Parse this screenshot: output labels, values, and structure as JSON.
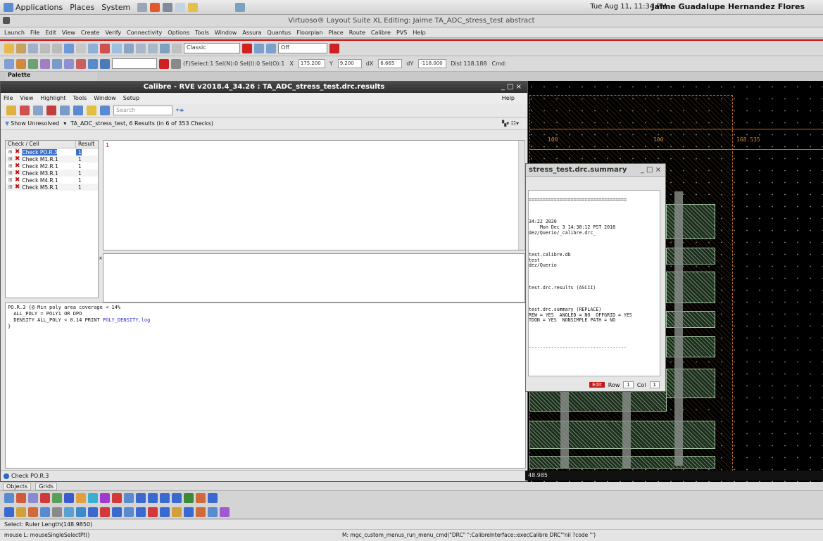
{
  "gnome": {
    "menus": [
      "Applications",
      "Places",
      "System"
    ],
    "clock": "Tue Aug 11, 11:34 PM",
    "user": "Jaime Guadalupe Hernandez Flores"
  },
  "virtuoso": {
    "title": "Virtuoso® Layout Suite XL Editing: Jaime TA_ADC_stress_test abstract",
    "menus": [
      "Launch",
      "File",
      "Edit",
      "View",
      "Create",
      "Verify",
      "Connectivity",
      "Options",
      "Tools",
      "Window",
      "Assura",
      "Quantus",
      "Floorplan",
      "Place",
      "Route",
      "Calibre",
      "PVS",
      "Help"
    ],
    "toolbar1": {
      "view_combo": "Classic",
      "off_combo": "Off"
    },
    "toolbar2": {
      "select_info": "(F)Select:1  Sel(N):0  Sel(I):0  Sel(O):1",
      "x_label": "X",
      "x_value": "175.200",
      "y_label": "Y",
      "y_value": "9.200",
      "dx_label": "dX",
      "dx_value": "6.665",
      "dy_label": "dY",
      "dy_value": "-118.000",
      "dist": "Dist 118.188",
      "cmd": "Cmd:"
    },
    "palette_label": "Palette"
  },
  "canvas": {
    "coord_labels": [
      "100",
      "100",
      "168.535"
    ],
    "status": "48.985"
  },
  "rve": {
    "title": "Calibre - RVE v2018.4_34.26 : TA_ADC_stress_test.drc.results",
    "window_ctrls": "_ □ ×",
    "menus": [
      "File",
      "View",
      "Highlight",
      "Tools",
      "Window",
      "Setup"
    ],
    "help": "Help",
    "search_placeholder": "Search",
    "filter_label": "Show Unresolved",
    "filter_summary": "TA_ADC_stress_test, 6 Results (in 6 of 353 Checks)",
    "tree_headers": [
      "Check / Cell",
      "Result"
    ],
    "checks": [
      {
        "name": "Check PO.R.3",
        "result": "1"
      },
      {
        "name": "Check M1.R.1",
        "result": "1"
      },
      {
        "name": "Check M2.R.1",
        "result": "1"
      },
      {
        "name": "Check M3.R.1",
        "result": "1"
      },
      {
        "name": "Check M4.R.1",
        "result": "1"
      },
      {
        "name": "Check M5.R.1",
        "result": "1"
      }
    ],
    "result_index": "1",
    "rule_text": {
      "l1": "PO.R.3 {@ Min poly area coverage < 14%",
      "l2": "  ALL_POLY = POLY1 OR DPO",
      "l3a": "  DENSITY ALL_POLY < 0.14 PRINT ",
      "l3b": "POLY_DENSITY.log",
      "l4": "}"
    },
    "status": "Check PO.R.3"
  },
  "summary": {
    "title": "stress_test.drc.summary",
    "window_ctrls": "_ □ ×",
    "text": "\n===================================\n\n\n\n34:22 2020\n    Mon Dec 3 14:38:12 PST 2018\ndez/Querio/_calibre.drc_\n\n\n\ntest.calibre.db\ntest\ndez/Querio\n\n\n\ntest.drc.results (ASCII)\n\n\n\ntest.drc.summary (REPLACE)\nREW = YES  ANGLED = NO  OFFGRID = YES\nTDON = YES  NONSIMPLE PATH = NO\n\n\n\n\n-----------------------------------",
    "edit": "Edit",
    "row_label": "Row",
    "row_value": "1",
    "col_label": "Col",
    "col_value": "1"
  },
  "bottom": {
    "tabs": [
      "Objects",
      "Grids"
    ],
    "status1": "Select:  Ruler  Length(148.9850)",
    "status2_left": "mouse L: mouseSingleSelectPt()",
    "status2_mid": "M: mgc_custom_menus_run_menu_cmd(\"DRC\" \":CalibreInterface::execCalibre DRC\"'nil ?code \"')"
  },
  "colors": {
    "accent_red": "#d01010",
    "select_blue": "#3a6fd0",
    "canvas": "#000000",
    "layout_orange": "#c26a1a"
  }
}
